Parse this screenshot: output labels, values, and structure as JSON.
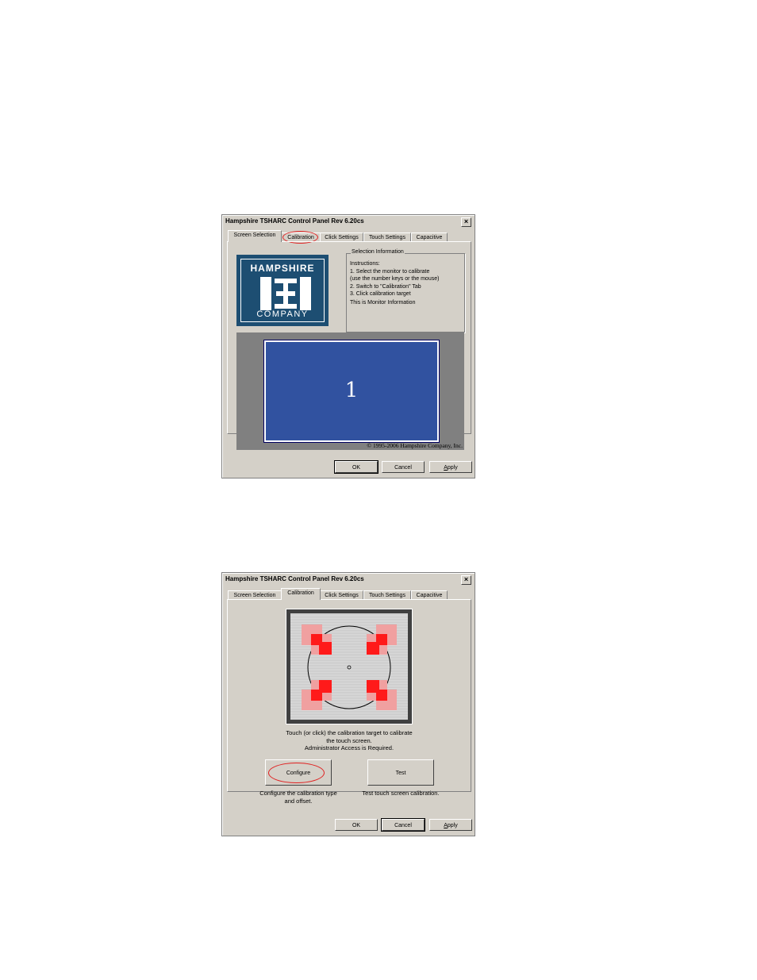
{
  "dialog1": {
    "title": "Hampshire TSHARC Control Panel Rev 6.20cs",
    "close_label": "×",
    "tabs": [
      "Screen Selection",
      "Calibration",
      "Click Settings",
      "Touch Settings",
      "Capacitive"
    ],
    "active_tab": "Screen Selection",
    "logo": {
      "top": "HAMPSHIRE",
      "bottom": "COMPANY"
    },
    "selection_info": {
      "legend": "Selection Information",
      "lines": [
        "Instructions:",
        "1. Select the monitor to calibrate",
        "(use the number keys or the mouse)",
        "2. Switch to \"Calibration\" Tab",
        "3. Click calibration target",
        "This is Monitor Information"
      ]
    },
    "monitor_number": "1",
    "copyright": "© 1995-2006 Hampshire Company, Inc.",
    "buttons": {
      "ok": "OK",
      "cancel": "Cancel",
      "apply": "Apply"
    }
  },
  "dialog2": {
    "title": "Hampshire TSHARC Control Panel Rev 6.20cs",
    "close_label": "×",
    "tabs": [
      "Screen Selection",
      "Calibration",
      "Click Settings",
      "Touch Settings",
      "Capacitive"
    ],
    "active_tab": "Calibration",
    "calibration_caption": [
      "Touch (or click) the calibration target to calibrate",
      "the touch screen.",
      "Administrator Access is Required."
    ],
    "configure": {
      "label": "Configure",
      "caption": [
        "Configure the calibration type",
        "and offset."
      ]
    },
    "test": {
      "label": "Test",
      "caption": "Test touch screen calibration."
    },
    "buttons": {
      "ok": "OK",
      "cancel": "Cancel",
      "apply": "Apply"
    }
  },
  "colors": {
    "highlight_ring": "#e02020",
    "logo_blue": "#1d4e72",
    "monitor_blue": "#3152a0"
  }
}
